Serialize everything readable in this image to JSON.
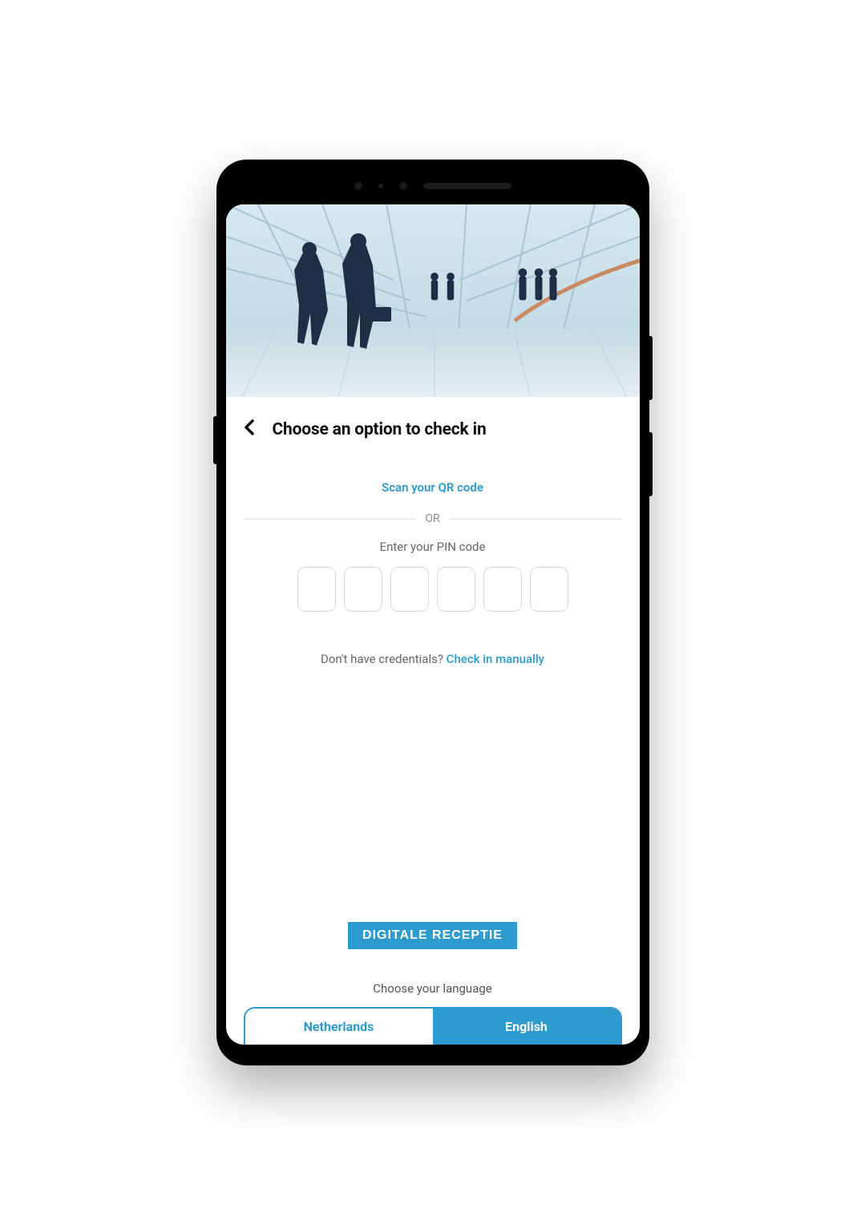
{
  "header": {
    "title": "Choose an option to check in"
  },
  "checkin": {
    "qr_prompt": "Scan your QR code",
    "divider_label": "OR",
    "pin_prompt": "Enter your PIN code",
    "pin_length": 6,
    "manual_prefix": "Don't have credentials? ",
    "manual_link": "Check in manually"
  },
  "brand": {
    "badge": "DIGITALE RECEPTIE"
  },
  "language": {
    "prompt": "Choose your language",
    "options": [
      {
        "label": "Netherlands",
        "active": false
      },
      {
        "label": "English",
        "active": true
      }
    ]
  },
  "colors": {
    "accent": "#2e9bcf",
    "text": "#111111",
    "muted": "#666666"
  }
}
